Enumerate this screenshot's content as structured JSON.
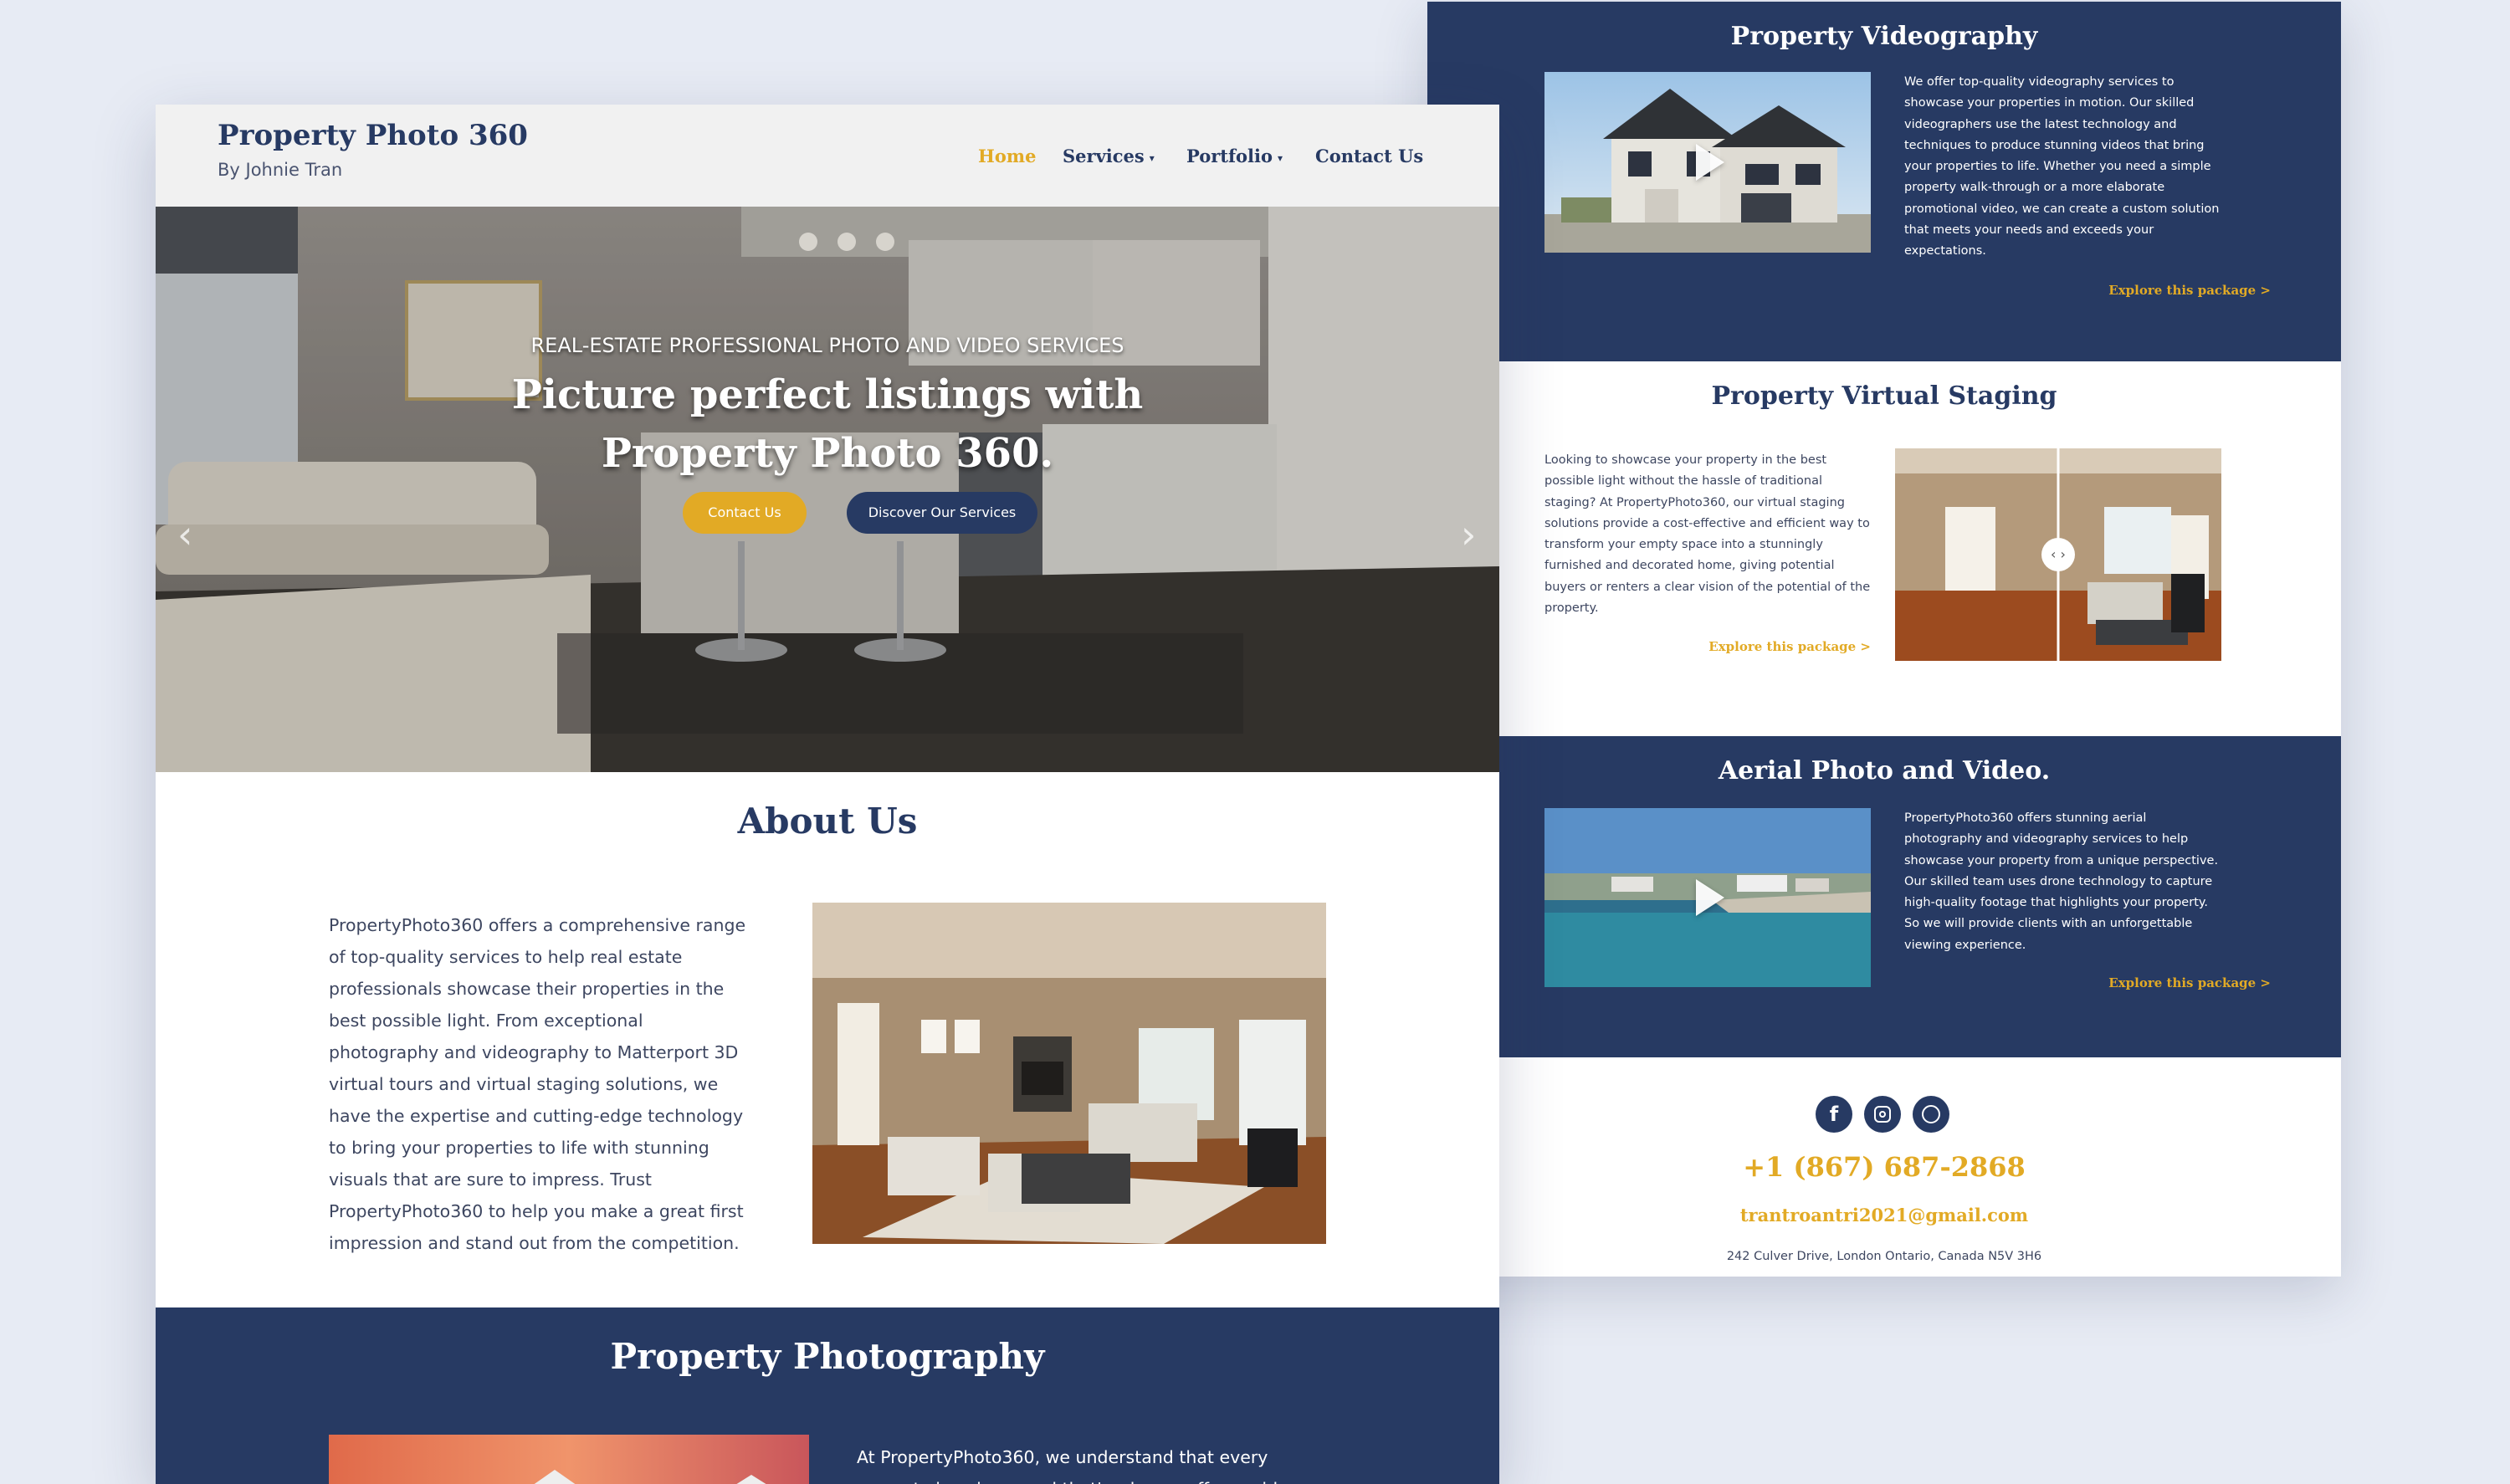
{
  "header": {
    "site_title": "Property Photo 360",
    "byline": "By Johnie Tran",
    "nav": [
      {
        "label": "Home",
        "active": true
      },
      {
        "label": "Services",
        "dropdown": true
      },
      {
        "label": "Portfolio",
        "dropdown": true
      },
      {
        "label": "Contact Us"
      }
    ]
  },
  "hero": {
    "eyebrow": "REAL-ESTATE PROFESSIONAL PHOTO AND VIDEO SERVICES",
    "headline_line1": "Picture perfect listings with",
    "headline_line2": "Property Photo 360.",
    "contact_button": "Contact Us",
    "services_button": "Discover Our Services",
    "prev_icon": "chevron-left-icon",
    "next_icon": "chevron-right-icon"
  },
  "about": {
    "title": "About Us",
    "lines": [
      "PropertyPhoto360 offers a comprehensive range",
      "of top-quality services to help real estate",
      "professionals showcase their properties in the",
      "best possible light. From exceptional",
      "photography and videography to Matterport 3D",
      "virtual tours and virtual staging solutions, we",
      "have the expertise and cutting-edge technology",
      "to bring your properties to life with stunning",
      "visuals that are sure to impress. Trust",
      "PropertyPhoto360 to help you make a great first",
      "impression and stand out from the competition."
    ]
  },
  "photography": {
    "title": "Property Photography",
    "lines": [
      "At PropertyPhoto360, we understand that every",
      "property is unique, and that's why we offer a wide"
    ]
  },
  "videography": {
    "title": "Property Videography",
    "lines": [
      "We offer top-quality videography services to",
      "showcase your properties in motion. Our skilled",
      "videographers use the latest technology and",
      "techniques to produce stunning videos that bring",
      "your properties to life. Whether you need a simple",
      "property walk-through or a more elaborate",
      "promotional video, we can create a custom solution",
      "that meets your needs and exceeds your",
      "expectations."
    ],
    "link": "Explore this package >"
  },
  "staging": {
    "title": "Property Virtual Staging",
    "lines": [
      "Looking to showcase your property in the best",
      "possible light without the hassle of traditional",
      "staging? At PropertyPhoto360, our virtual staging",
      "solutions provide a cost-effective and efficient way to",
      "transform your empty space into a stunningly",
      "furnished and decorated home, giving potential",
      "buyers or renters a clear vision of the potential of the",
      "property."
    ],
    "link": "Explore this package >",
    "compare_handle": "‹ ›"
  },
  "aerial": {
    "title": "Aerial Photo and Video.",
    "lines": [
      "PropertyPhoto360 offers stunning aerial",
      "photography and videography services to help",
      "showcase your property from a unique perspective.",
      "Our skilled team uses drone technology to capture",
      "high-quality footage that highlights your property.",
      "So we will provide clients with an unforgettable",
      "viewing experience."
    ],
    "link": "Explore this package >"
  },
  "footer": {
    "social_icons": [
      "facebook-icon",
      "instagram-icon",
      "whatsapp-icon"
    ],
    "phone": "+1 (867) 687-2868",
    "email": "trantroantri2021@gmail.com",
    "address": "242 Culver Drive, London Ontario, Canada N5V 3H6"
  },
  "colors": {
    "navy": "#273a63",
    "gold": "#e2aa25",
    "page_bg": "#e7ebf4"
  }
}
